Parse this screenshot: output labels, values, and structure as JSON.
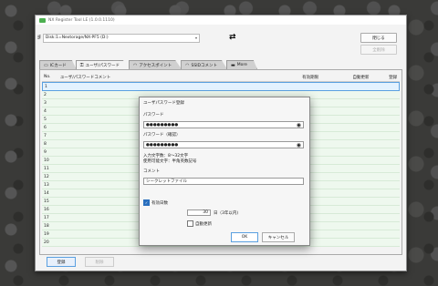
{
  "window": {
    "title": "NX Register Tool LE (1.0.0.1110)"
  },
  "toolbar": {
    "disk_value": "Disk:1=Nextorage/NX-PF5 (D:)",
    "close_label": "閉じる",
    "delete_all_label": "全削除"
  },
  "tabs": [
    {
      "label": "ICカード",
      "icon": "card-icon"
    },
    {
      "label": "ユーザ/パスワード",
      "icon": "key-icon"
    },
    {
      "label": "アクセスポイント",
      "icon": "wifi-icon"
    },
    {
      "label": "SSIDコメント",
      "icon": "wifi-icon"
    },
    {
      "label": "More",
      "icon": "folder-icon"
    }
  ],
  "table": {
    "headers": {
      "no": "No.",
      "comment": "ユーザ/パスワードコメント",
      "expiry": "有効期限",
      "auto": "自動更新",
      "delete": "登録"
    },
    "rows": [
      "1",
      "2",
      "3",
      "4",
      "5",
      "6",
      "7",
      "8",
      "9",
      "10",
      "11",
      "12",
      "13",
      "14",
      "15",
      "16",
      "17",
      "18",
      "19",
      "20"
    ]
  },
  "buttons": {
    "register": "登録",
    "delete": "削除"
  },
  "dialog": {
    "title": "ユーザパスワード登録",
    "password_label": "パスワード",
    "password_value": "●●●●●●●●●",
    "confirm_label": "パスワード（確認）",
    "confirm_value": "●●●●●●●●●",
    "info_line1": "入力文字数：8～32文字",
    "info_line2": "使用可能文字：半角英数記号",
    "comment_label": "コメント",
    "comment_value": "シークレットファイル",
    "days_label": "有効日数",
    "days_value": "30",
    "days_unit": "日（3年以内)",
    "auto_update_label": "自動更新",
    "ok_label": "OK",
    "cancel_label": "キャンセル"
  },
  "colors": {
    "accent": "#2a6fbe",
    "row_bg": "#eef8ee",
    "selected_row": "#e3f2ff"
  }
}
